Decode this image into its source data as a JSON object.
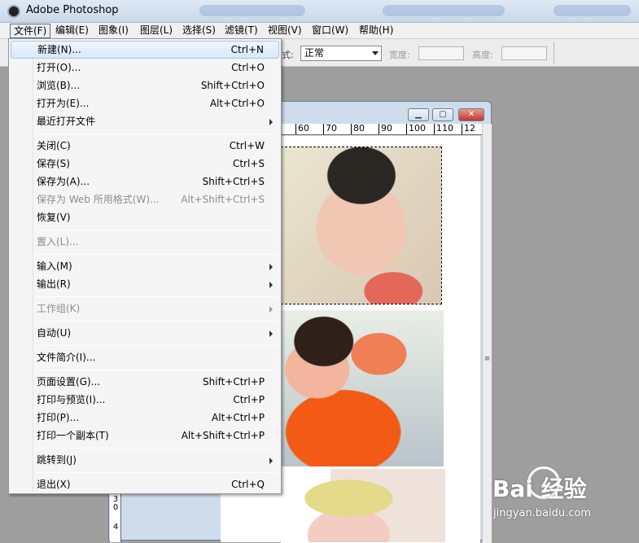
{
  "app": {
    "title": "Adobe Photoshop"
  },
  "menubar": [
    "文件(F)",
    "编辑(E)",
    "图象(I)",
    "图层(L)",
    "选择(S)",
    "滤镜(T)",
    "视图(V)",
    "窗口(W)",
    "帮助(H)"
  ],
  "options_bar": {
    "style_label": "式:",
    "style_value": "正常",
    "width_label": "宽度:",
    "height_label": "高度:"
  },
  "document_window": {
    "ruler_top": [
      "60",
      "70",
      "80",
      "90",
      "100",
      "110",
      "12"
    ],
    "ruler_left": [
      "3",
      "0",
      "4"
    ]
  },
  "file_menu": {
    "items": [
      {
        "label": "新建(N)...",
        "shortcut": "Ctrl+N"
      },
      {
        "label": "打开(O)...",
        "shortcut": "Ctrl+O"
      },
      {
        "label": "浏览(B)...",
        "shortcut": "Shift+Ctrl+O"
      },
      {
        "label": "打开为(E)...",
        "shortcut": "Alt+Ctrl+O"
      },
      {
        "label": "最近打开文件",
        "shortcut": ""
      },
      {
        "label": "关闭(C)",
        "shortcut": "Ctrl+W"
      },
      {
        "label": "保存(S)",
        "shortcut": "Ctrl+S"
      },
      {
        "label": "保存为(A)...",
        "shortcut": "Shift+Ctrl+S"
      },
      {
        "label": "保存为 Web 所用格式(W)...",
        "shortcut": "Alt+Shift+Ctrl+S"
      },
      {
        "label": "恢复(V)",
        "shortcut": ""
      },
      {
        "label": "置入(L)...",
        "shortcut": ""
      },
      {
        "label": "输入(M)",
        "shortcut": ""
      },
      {
        "label": "输出(R)",
        "shortcut": ""
      },
      {
        "label": "工作组(K)",
        "shortcut": ""
      },
      {
        "label": "自动(U)",
        "shortcut": ""
      },
      {
        "label": "文件简介(I)...",
        "shortcut": ""
      },
      {
        "label": "页面设置(G)...",
        "shortcut": "Shift+Ctrl+P"
      },
      {
        "label": "打印与预览(I)...",
        "shortcut": "Ctrl+P"
      },
      {
        "label": "打印(P)...",
        "shortcut": "Alt+Ctrl+P"
      },
      {
        "label": "打印一个副本(T)",
        "shortcut": "Alt+Shift+Ctrl+P"
      },
      {
        "label": "跳转到(J)",
        "shortcut": ""
      },
      {
        "label": "退出(X)",
        "shortcut": "Ctrl+Q"
      }
    ]
  },
  "watermark": {
    "logo": "Bai 经验",
    "url": "jingyan.baidu.com"
  },
  "colors": {
    "menu_highlight": "#d9e8fa",
    "disabled_text": "#8d8d8d",
    "close_button": "#c0392b"
  }
}
